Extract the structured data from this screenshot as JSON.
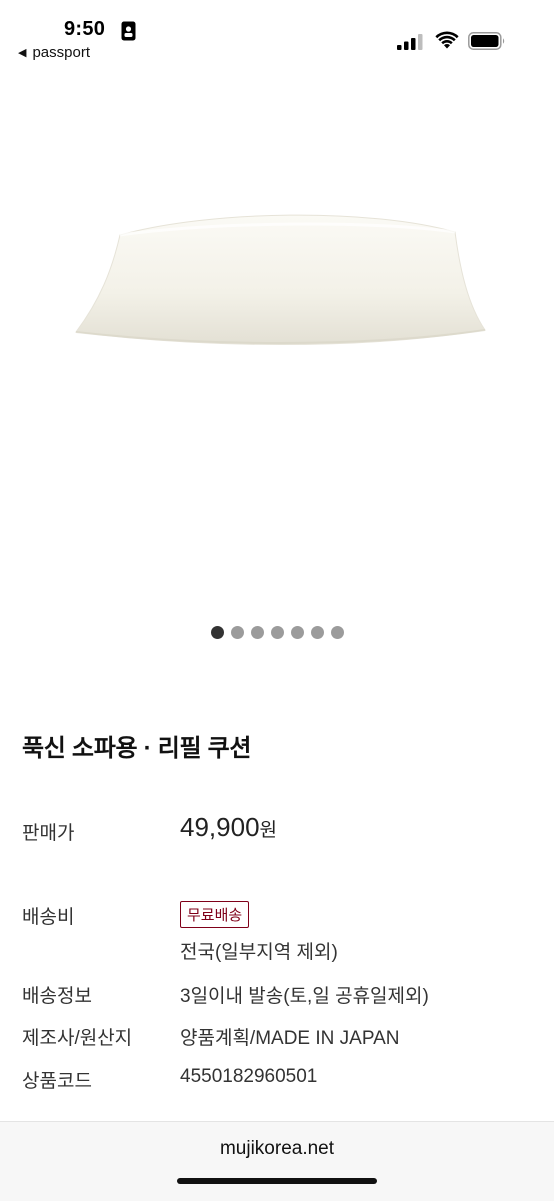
{
  "status_bar": {
    "time": "9:50",
    "back_label": "passport"
  },
  "carousel": {
    "total": 7,
    "active_index": 0
  },
  "product": {
    "title": "푹신 소파용 · 리필 쿠션",
    "price_label": "판매가",
    "price_value": "49,900",
    "price_unit": "원",
    "shipping_fee_label": "배송비",
    "shipping_badge": "무료배송",
    "shipping_fee_note": "전국(일부지역 제외)",
    "shipping_info_label": "배송정보",
    "shipping_info_value": "3일이내 발송(토,일 공휴일제외)",
    "maker_label": "제조사/원산지",
    "maker_value": "양품계획/MADE IN JAPAN",
    "code_label": "상품코드",
    "code_value": "4550182960501"
  },
  "browser": {
    "url": "mujikorea.net"
  },
  "colors": {
    "badge": "#7f0019",
    "dot_active": "#333333",
    "dot_inactive": "#9b9b9b"
  }
}
